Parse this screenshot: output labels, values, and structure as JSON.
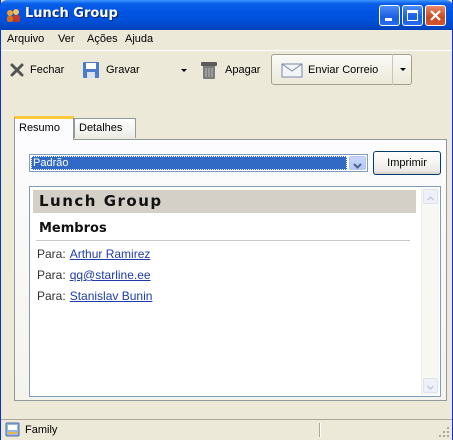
{
  "window": {
    "title": "Lunch Group"
  },
  "menubar": {
    "items": [
      {
        "label": "Arquivo"
      },
      {
        "label": "Ver"
      },
      {
        "label": "Ações"
      },
      {
        "label": "Ajuda"
      }
    ]
  },
  "toolbar": {
    "close_label": "Fechar",
    "save_label": "Gravar",
    "delete_label": "Apagar",
    "send_label": "Enviar Correio"
  },
  "tabs": [
    {
      "label": "Resumo",
      "active": true
    },
    {
      "label": "Detalhes",
      "active": false
    }
  ],
  "template_select": {
    "selected": "Padrão"
  },
  "print_button": {
    "label": "Imprimir"
  },
  "summary": {
    "group_name": "Lunch Group",
    "members_heading": "Membros",
    "to_prefix": "Para:",
    "members": [
      {
        "prefix": "Para:",
        "name": "Arthur Ramirez"
      },
      {
        "prefix": "Para:",
        "name": "qq@starline.ee"
      },
      {
        "prefix": "Para:",
        "name": "Stanislav Bunin"
      }
    ]
  },
  "statusbar": {
    "category": "Family"
  },
  "colors": {
    "titlebar": "#0054e3",
    "window_face": "#ece9d8",
    "selection": "#316ac5",
    "link": "#1e3ca8",
    "tab_highlight": "#ffc83c"
  }
}
